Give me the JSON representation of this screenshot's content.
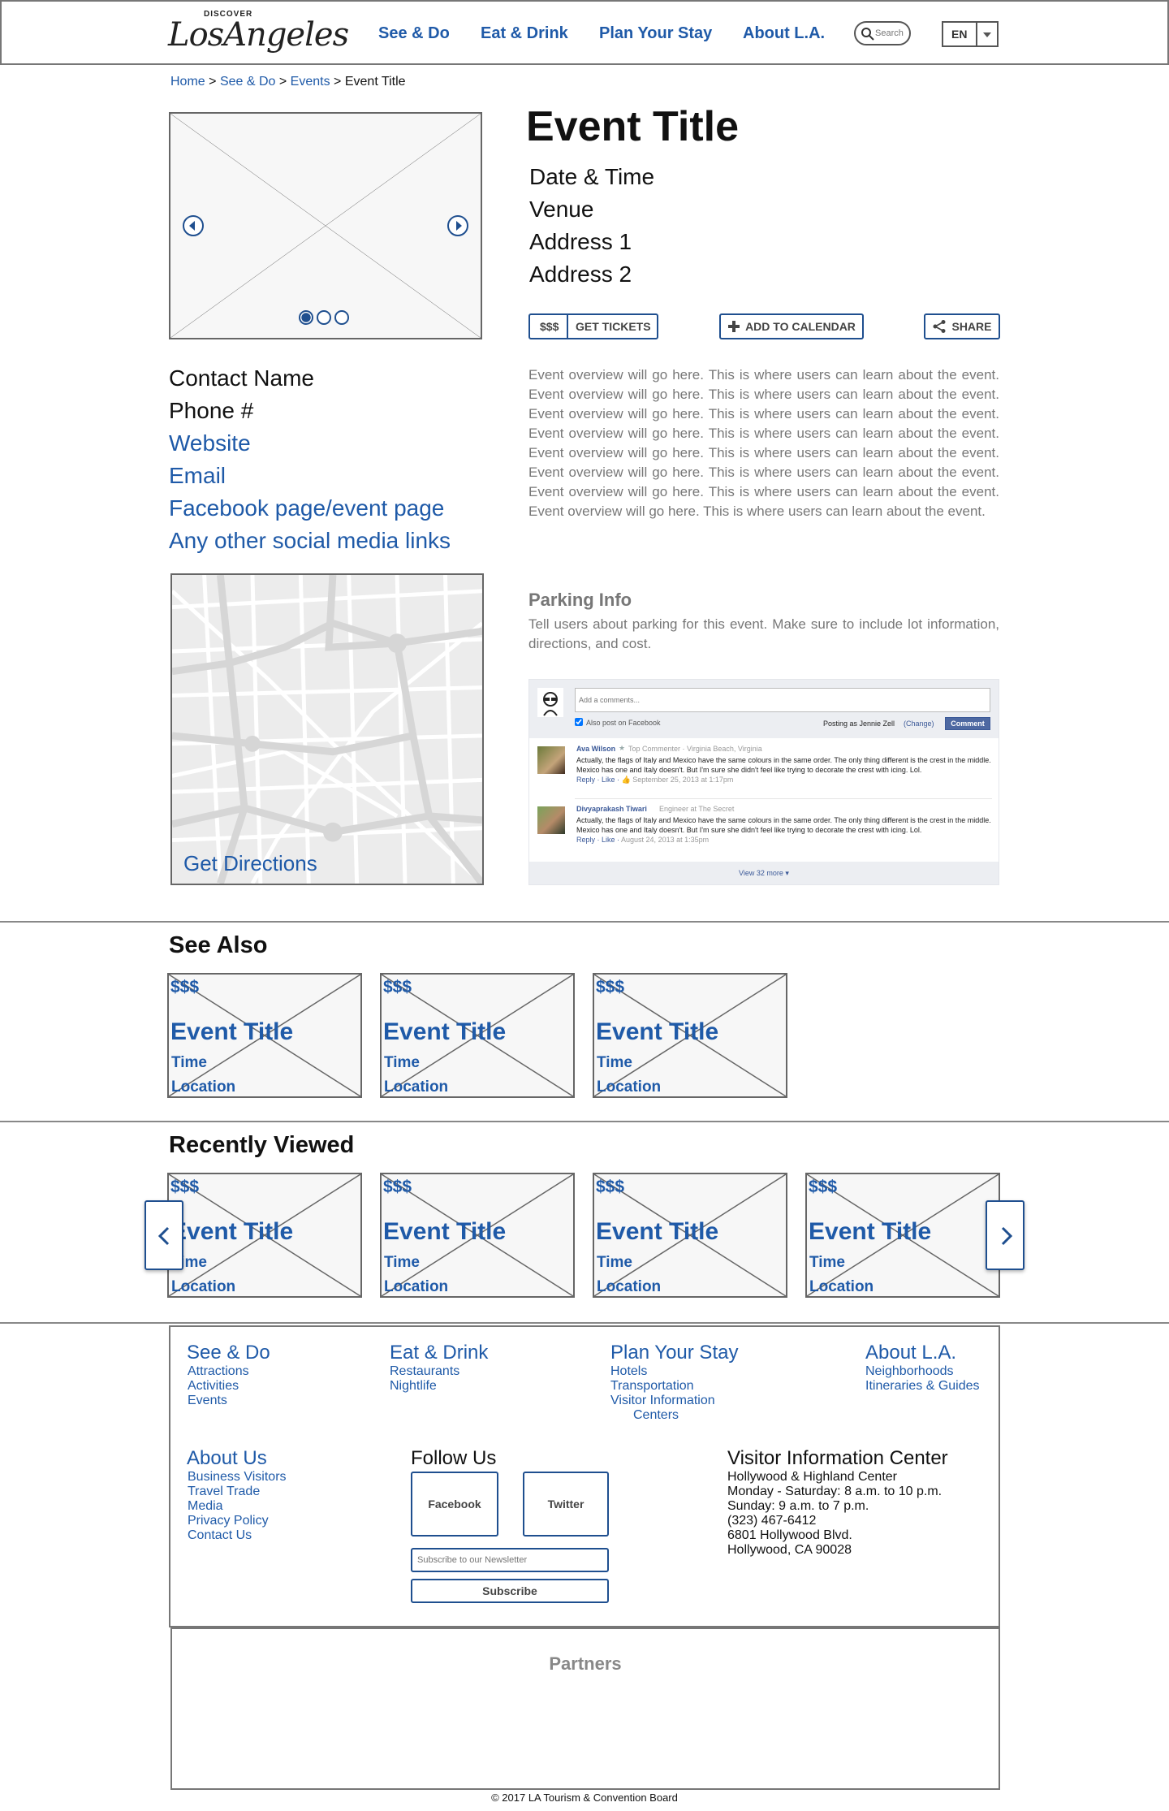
{
  "header": {
    "logo_small": "DISCOVER",
    "logo_main": "LosAngeles",
    "nav": [
      "See & Do",
      "Eat & Drink",
      "Plan Your Stay",
      "About L.A."
    ],
    "search_placeholder": "Search",
    "language": "EN"
  },
  "breadcrumb": {
    "items": [
      "Home",
      "See & Do",
      "Events"
    ],
    "separator": ">",
    "current": "Event Title"
  },
  "event": {
    "title": "Event Title",
    "details": [
      "Date & Time",
      "Venue",
      "Address 1",
      "Address 2"
    ],
    "price_label": "$$$",
    "tickets_label": "GET TICKETS",
    "calendar_label": "ADD TO CALENDAR",
    "share_label": "SHARE",
    "overview": "Event overview will go here. This is where users can learn about the event. Event overview will go here. This is where users can learn about the event. Event overview will go here. This is where users can learn about the event. Event overview will go here. This is where users can learn about the event. Event overview will go here. This is where users can learn about the event. Event overview will go here. This is where users can learn about the event. Event overview will go here. This is where users can learn about the event. Event overview will go here. This is where users can learn about the event.",
    "parking_title": "Parking Info",
    "parking_text": "Tell users about parking for this event. Make sure to include lot information, directions, and cost."
  },
  "contact": {
    "name": "Contact Name",
    "phone": "Phone #",
    "website": "Website",
    "email": "Email",
    "facebook": "Facebook page/event page",
    "social": "Any other social media links"
  },
  "map": {
    "directions_label": "Get Directions"
  },
  "comments": {
    "placeholder": "Add a comments...",
    "also_post": "Also post on Facebook",
    "posting_as": "Posting as Jennie Zell",
    "change": "(Change)",
    "submit": "Comment",
    "items": [
      {
        "author": "Ava Wilson",
        "meta": "Top Commenter · Virginia Beach, Virginia",
        "text": "Actually, the flags of Italy and Mexico have the same colours in the same order. The only thing different is the crest in the middle. Mexico has one and Italy doesn't. But I'm sure she didn't feel like trying to decorate the crest with icing. Lol.",
        "actions": "Reply · Like · ",
        "date": "September 25, 2013 at 1:17pm"
      },
      {
        "author": "Divyaprakash Tiwari",
        "meta": "Engineer at The Secret",
        "text": "Actually, the flags of Italy and Mexico have the same colours in the same order. The only thing different is the crest in the middle. Mexico has one and Italy doesn't. But I'm sure she didn't feel like trying to decorate the crest with icing. Lol.",
        "actions": "Reply · Like · ",
        "date": "August 24, 2013 at 1:35pm"
      }
    ],
    "view_more": "View 32 more"
  },
  "see_also": {
    "title": "See Also",
    "cards": [
      {
        "price": "$$$",
        "title": "Event Title",
        "time": "Time",
        "location": "Location"
      },
      {
        "price": "$$$",
        "title": "Event Title",
        "time": "Time",
        "location": "Location"
      },
      {
        "price": "$$$",
        "title": "Event Title",
        "time": "Time",
        "location": "Location"
      }
    ]
  },
  "recently_viewed": {
    "title": "Recently Viewed",
    "cards": [
      {
        "price": "$$$",
        "title": "Event Title",
        "time": "Time",
        "location": "Location"
      },
      {
        "price": "$$$",
        "title": "Event Title",
        "time": "Time",
        "location": "Location"
      },
      {
        "price": "$$$",
        "title": "Event Title",
        "time": "Time",
        "location": "Location"
      },
      {
        "price": "$$$",
        "title": "Event Title",
        "time": "Time",
        "location": "Location"
      }
    ]
  },
  "footer": {
    "columns": [
      {
        "title": "See & Do",
        "items": [
          "Attractions",
          "Activities",
          "Events"
        ]
      },
      {
        "title": "Eat & Drink",
        "items": [
          "Restaurants",
          "Nightlife"
        ]
      },
      {
        "title": "Plan Your Stay",
        "items": [
          "Hotels",
          "Transportation",
          "Visitor Information",
          "Centers"
        ]
      },
      {
        "title": "About L.A.",
        "items": [
          "Neighborhoods",
          "Itineraries & Guides"
        ]
      }
    ],
    "about": {
      "title": "About Us",
      "items": [
        "Business Visitors",
        "Travel Trade",
        "Media",
        "Privacy Policy",
        "Contact Us"
      ]
    },
    "follow": {
      "title": "Follow Us",
      "facebook": "Facebook",
      "twitter": "Twitter",
      "newsletter_placeholder": "Subscribe to our Newsletter",
      "subscribe": "Subscribe"
    },
    "visitor_center": {
      "title": "Visitor Information Center",
      "lines": [
        "Hollywood & Highland Center",
        "Monday - Saturday: 8 a.m. to 10 p.m.",
        "Sunday: 9 a.m. to 7 p.m.",
        "(323) 467-6412",
        "6801 Hollywood Blvd.",
        "Hollywood, CA 90028"
      ]
    },
    "partners": "Partners",
    "copyright": "© 2017 LA Tourism & Convention Board"
  },
  "colors": {
    "accent": "#1f5aa8",
    "border": "#666666",
    "placeholder_fill": "#f7f7f7"
  }
}
